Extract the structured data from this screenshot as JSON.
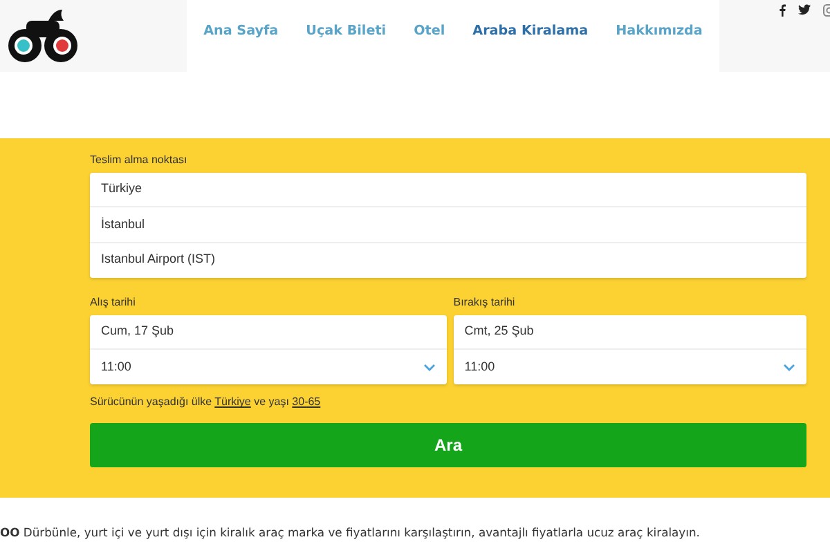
{
  "nav": {
    "items": [
      {
        "label": "Ana Sayfa",
        "selected": false
      },
      {
        "label": "Uçak Bileti",
        "selected": false
      },
      {
        "label": "Otel",
        "selected": false
      },
      {
        "label": "Araba Kiralama",
        "selected": true
      },
      {
        "label": "Hakkımızda",
        "selected": false
      }
    ]
  },
  "search_form": {
    "pickup": {
      "label": "Teslim alma noktası",
      "rows": [
        "Türkiye",
        "İstanbul",
        "Istanbul Airport (IST)"
      ]
    },
    "dates": [
      {
        "label": "Alış tarihi",
        "date": "Cum, 17 Şub",
        "time": "11:00"
      },
      {
        "label": "Bırakış tarihi",
        "date": "Cmt, 25 Şub",
        "time": "11:00"
      }
    ],
    "driver": {
      "before": "Sürücünün yaşadığı ülke",
      "country": "Türkiye",
      "middle": "ve yaşı",
      "age": "30-65"
    },
    "button": "Ara"
  },
  "intro_text": "**OO** Dürbünle, yurt içi ve yurt dışı için kiralık araç marka ve fiyatlarını karşılaştırın, avantajlı fiyatlarla ucuz araç kiralayın."
}
